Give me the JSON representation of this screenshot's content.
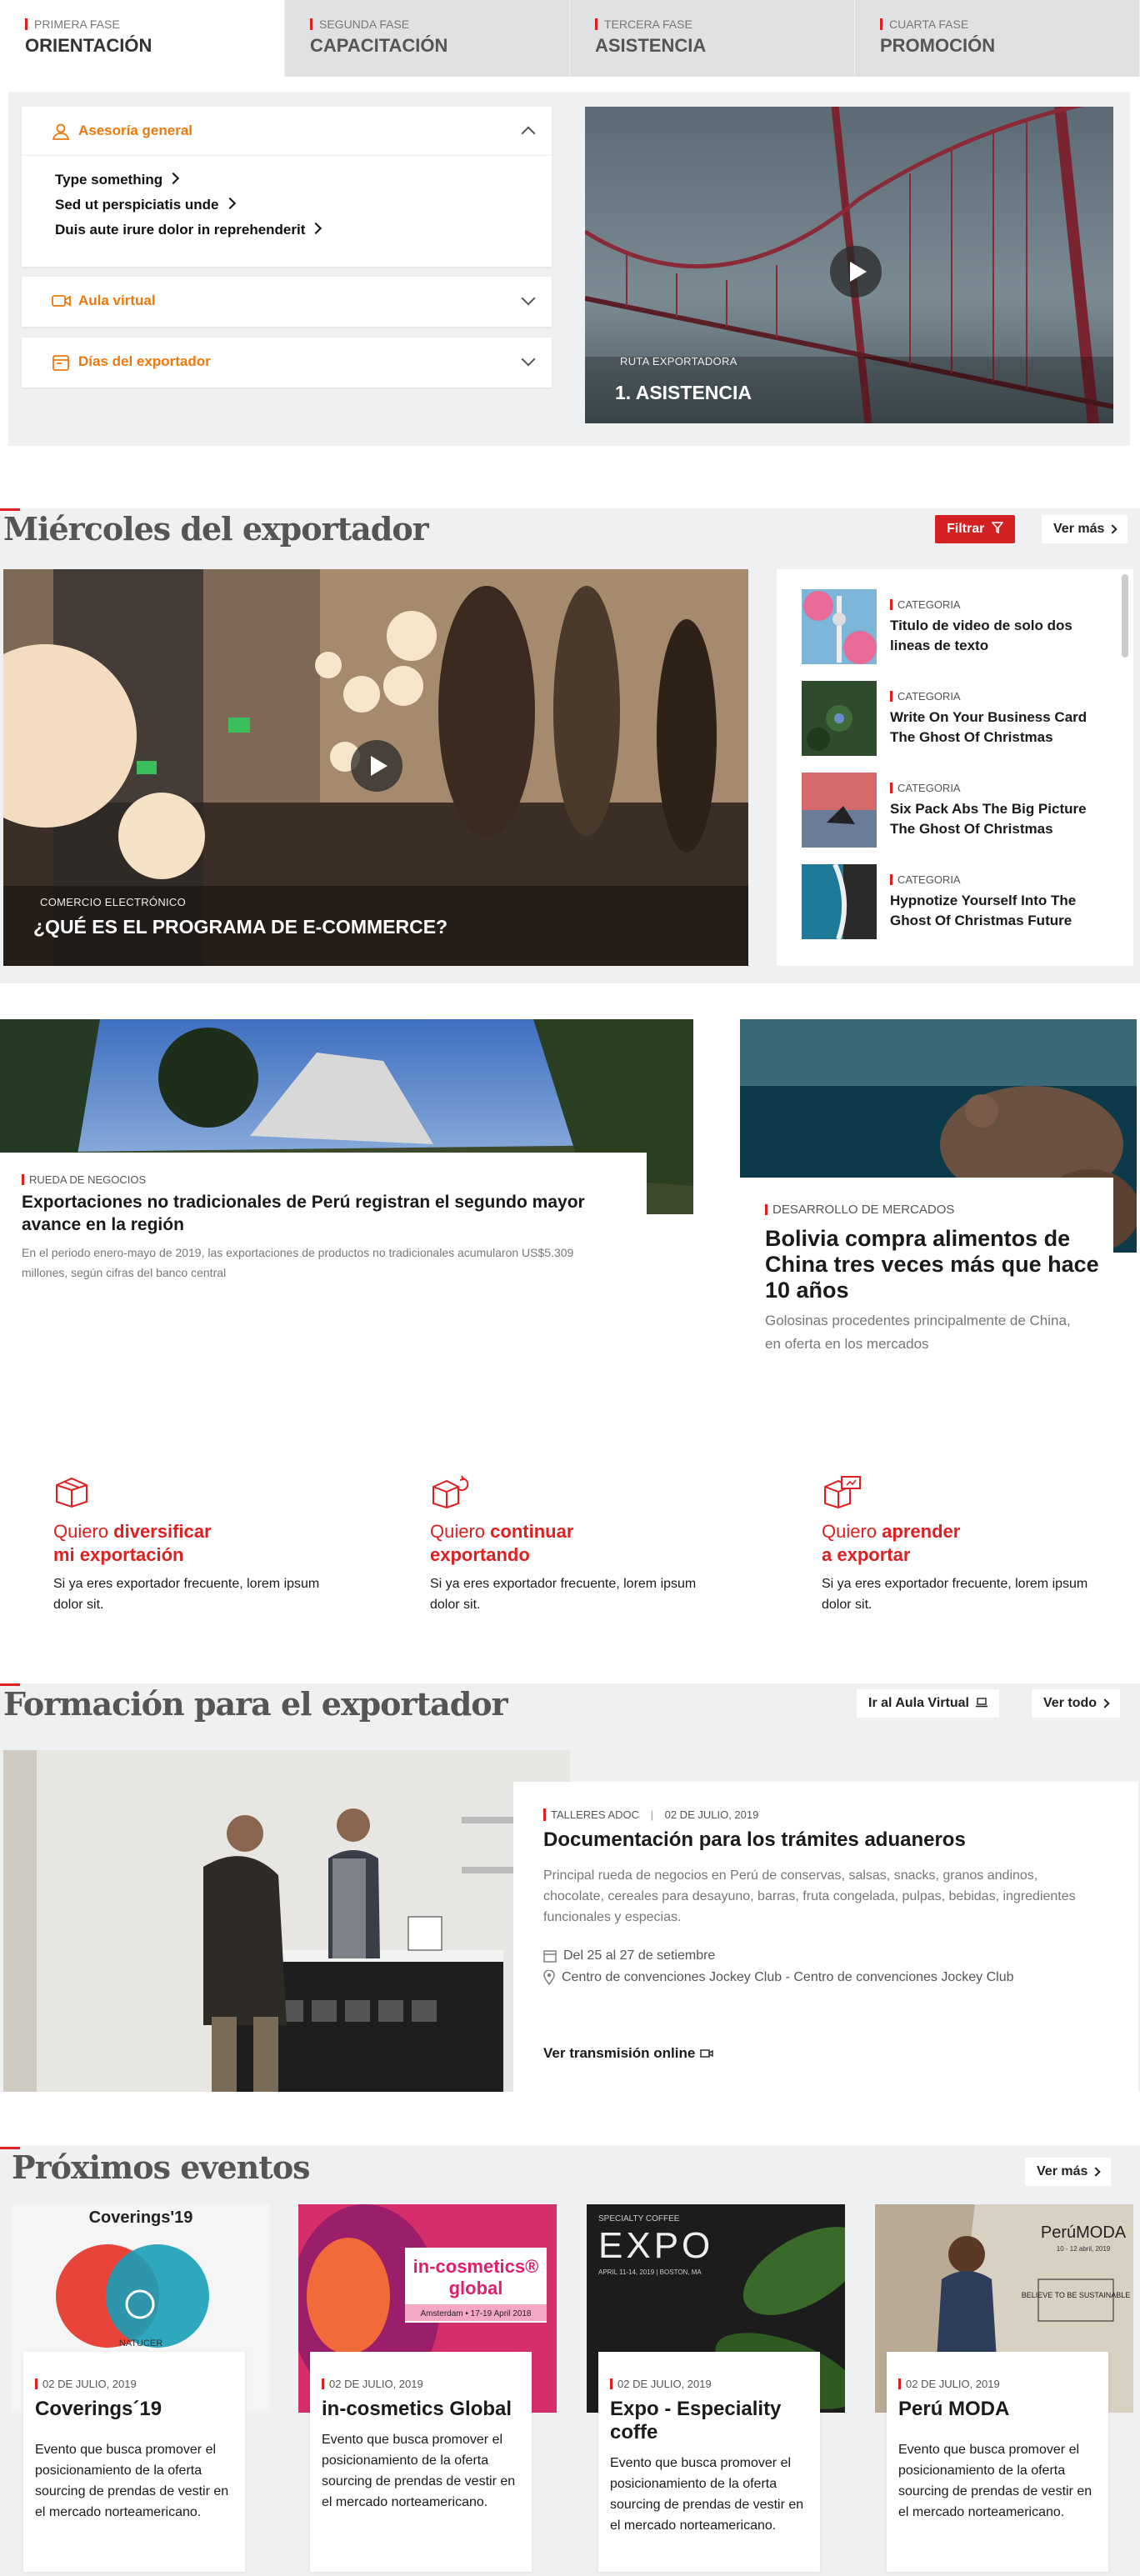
{
  "tabs": [
    {
      "phase": "PRIMERA FASE",
      "name": "ORIENTACIÓN"
    },
    {
      "phase": "SEGUNDA FASE",
      "name": "CAPACITACIÓN"
    },
    {
      "phase": "TERCERA FASE",
      "name": "ASISTENCIA"
    },
    {
      "phase": "CUARTA FASE",
      "name": "PROMOCIÓN"
    }
  ],
  "accordion": {
    "general": {
      "title": "Asesoría general",
      "links": [
        "Type something",
        "Sed ut perspiciatis unde",
        "Duis aute irure dolor in reprehenderit"
      ]
    },
    "aula": {
      "title": "Aula virtual"
    },
    "dias": {
      "title": "Días del exportador"
    }
  },
  "hero_video": {
    "subtitle": "RUTA EXPORTADORA",
    "title": "1. ASISTENCIA"
  },
  "miercoles": {
    "title": "Miércoles del exportador",
    "filter_label": "Filtrar",
    "more_label": "Ver más",
    "feature": {
      "category": "COMERCIO ELECTRÓNICO",
      "title": "¿QUÉ ES EL PROGRAMA DE E-COMMERCE?"
    },
    "list": [
      {
        "category": "CATEGORIA",
        "title": "Titulo de video de solo dos lineas de texto"
      },
      {
        "category": "CATEGORIA",
        "title": "Write On Your Business Card The Ghost Of Christmas"
      },
      {
        "category": "CATEGORIA",
        "title": "Six Pack Abs The Big Picture The Ghost Of Christmas"
      },
      {
        "category": "CATEGORIA",
        "title": "Hypnotize Yourself Into The Ghost Of Christmas Future"
      }
    ]
  },
  "news": [
    {
      "category": "RUEDA DE NEGOCIOS",
      "title": "Exportaciones no tradicionales de Perú registran el segundo mayor avance en la región",
      "desc": "En el periodo enero-mayo de 2019, las exportaciones de productos no tradicionales acumularon US$5.309 millones, según cifras del banco central"
    },
    {
      "category": "DESARROLLO DE MERCADOS",
      "title": "Bolivia compra alimentos de China tres veces más que hace 10 años",
      "desc": "Golosinas procedentes principalmente de China, en oferta en los mercados"
    }
  ],
  "why": [
    {
      "pre": "Quiero ",
      "bold": "diversificar",
      "line2": "mi exportación",
      "desc": "Si ya eres exportador frecuente, lorem ipsum dolor sit."
    },
    {
      "pre": "Quiero ",
      "bold": "continuar",
      "line2": "exportando",
      "desc": "Si ya eres exportador frecuente, lorem ipsum dolor sit."
    },
    {
      "pre": "Quiero ",
      "bold": "aprender",
      "line2": "a exportar",
      "desc": "Si ya eres exportador frecuente, lorem ipsum dolor sit."
    }
  ],
  "formacion": {
    "title": "Formación para el exportador",
    "aula_label": "Ir al Aula Virtual",
    "all_label": "Ver todo",
    "card": {
      "category": "TALLERES ADOC",
      "date": "02 DE JULIO, 2019",
      "title": "Documentación para los trámites aduaneros",
      "desc": "Principal rueda de negocios en Perú de conservas, salsas, snacks, granos andinos, chocolate, cereales para desayuno, barras, fruta congelada, pulpas, bebidas, ingredientes funcionales y especias.",
      "when": "Del 25 al 27 de setiembre",
      "where": "Centro de convenciones Jockey Club - Centro de convenciones Jockey Club",
      "cta": "Ver transmisión online"
    }
  },
  "eventos": {
    "title": "Próximos eventos",
    "more_label": "Ver más",
    "items": [
      {
        "date": "02 DE JULIO, 2019",
        "title": "Coverings´19",
        "desc": "Evento que busca promover el posicionamiento de la oferta sourcing de prendas de vestir en el mercado norteamericano.",
        "poster": {
          "brand": "Coverings'19",
          "sub": "NATUCER"
        }
      },
      {
        "date": "02 DE JULIO, 2019",
        "title": "in-cosmetics Global",
        "desc": "Evento que busca promover el posicionamiento de la oferta sourcing de prendas de vestir en el mercado norteamericano.",
        "poster": {
          "brand": "in-cosmetics®",
          "sub": "global",
          "extra": "Amsterdam • 17-19 April 2018"
        }
      },
      {
        "date": "02 DE JULIO, 2019",
        "title": "Expo - Especiality coffe",
        "desc": "Evento que busca promover el posicionamiento de la oferta sourcing de prendas de vestir en el mercado norteamericano.",
        "poster": {
          "brand": "SPECIALTY COFFEE",
          "sub": "EXPO",
          "extra": "APRIL 11-14, 2019 | BOSTON, MA"
        }
      },
      {
        "date": "02 DE JULIO, 2019",
        "title": "Perú MODA",
        "desc": "Evento que busca promover el posicionamiento de la oferta sourcing de prendas de vestir en el mercado norteamericano.",
        "poster": {
          "brand": "PerúMODA",
          "sub": "10 - 12 abril, 2019",
          "extra": "BELIEVE TO BE SUSTAINABLE"
        }
      }
    ]
  },
  "colors": {
    "accent": "#e02020",
    "orange": "#f0780a",
    "bg_grey": "#eef0f2"
  }
}
